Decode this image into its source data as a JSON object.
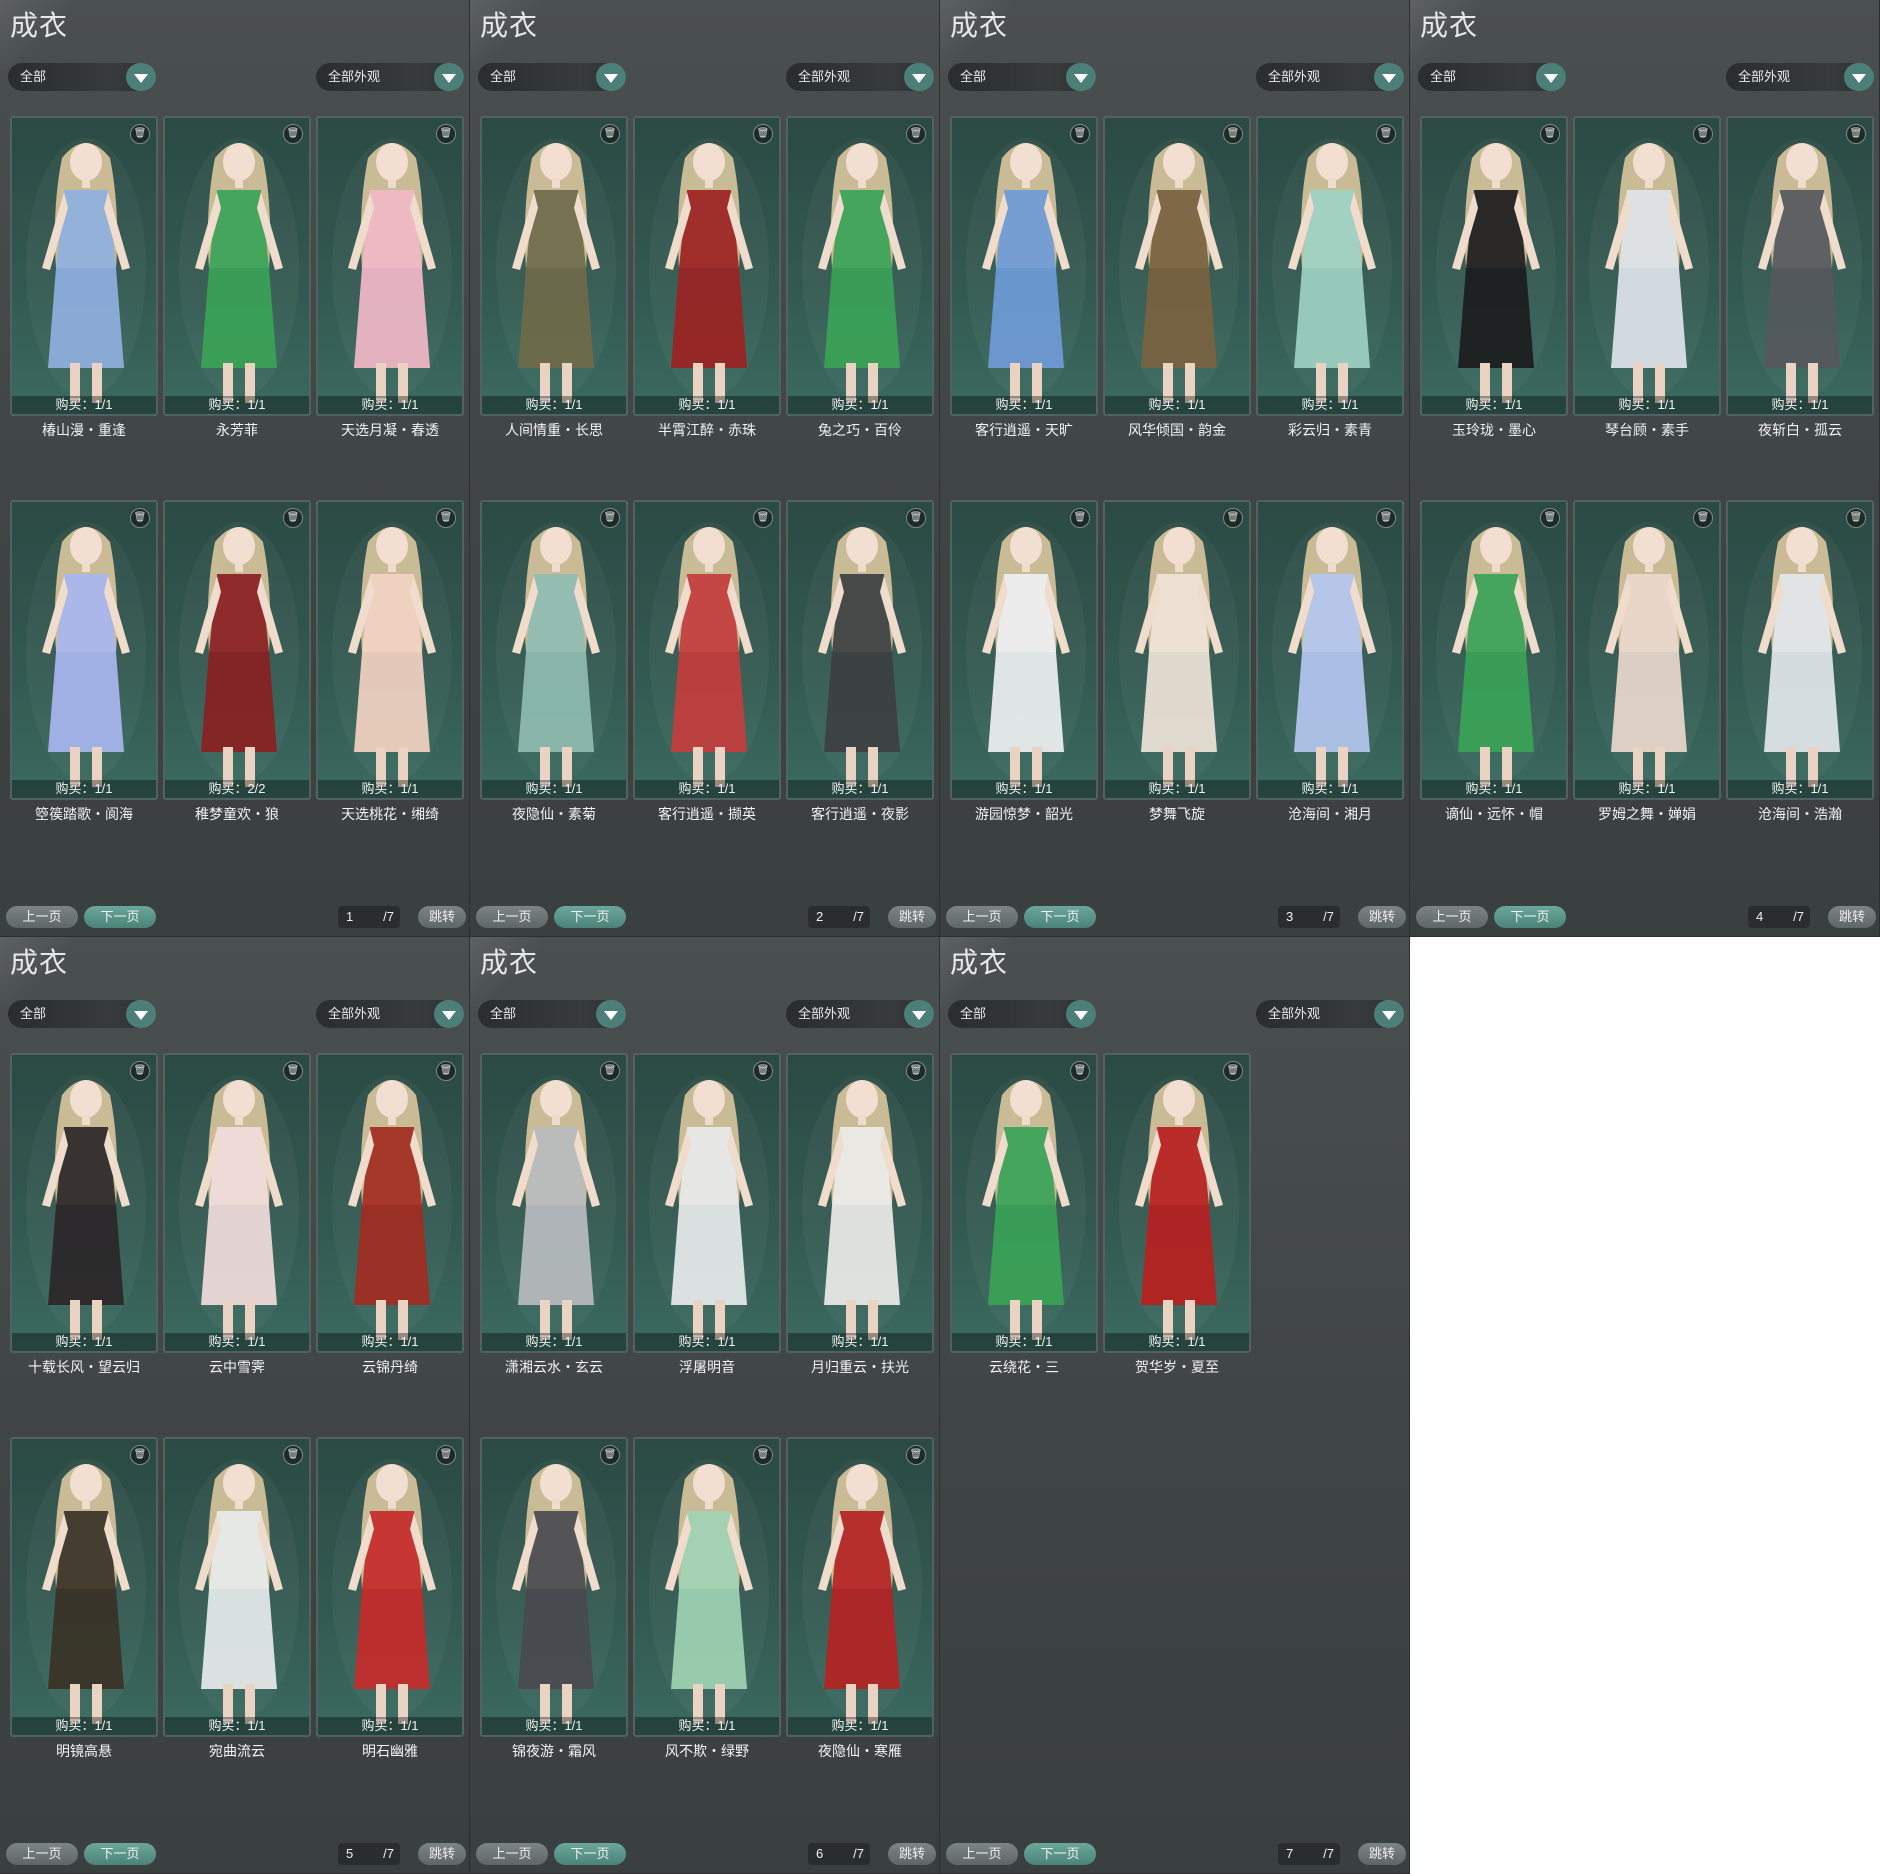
{
  "pages": [
    {
      "title": "成衣",
      "filter_left": "全部",
      "filter_right": "全部外观",
      "prev_label": "上一页",
      "next_label": "下一页",
      "page_number": "1",
      "page_total": "/7",
      "jump_label": "跳转",
      "items": [
        {
          "name": "椿山漫・重逢",
          "buy": "购买：1/1",
          "color": "#8fb0e0"
        },
        {
          "name": "永芳菲",
          "buy": "购买：1/1",
          "color": "#3aa357"
        },
        {
          "name": "天选月凝・春透",
          "buy": "购买：1/1",
          "color": "#f2b8c8"
        },
        {
          "name": "箜篌踏歌・阆海",
          "buy": "购买：1/1",
          "color": "#a9b6f0"
        },
        {
          "name": "稚梦童欢・狼",
          "buy": "购买：2/2",
          "color": "#8a1f22"
        },
        {
          "name": "天选桃花・缃绮",
          "buy": "购买：1/1",
          "color": "#f3d3c2"
        }
      ]
    },
    {
      "title": "成衣",
      "filter_left": "全部",
      "filter_right": "全部外观",
      "prev_label": "上一页",
      "next_label": "下一页",
      "page_number": "2",
      "page_total": "/7",
      "jump_label": "跳转",
      "items": [
        {
          "name": "人间情重・长思",
          "buy": "购买：1/1",
          "color": "#6f6a4a"
        },
        {
          "name": "半霄江醉・赤珠",
          "buy": "购买：1/1",
          "color": "#9c2323"
        },
        {
          "name": "兔之巧・百伶",
          "buy": "购买：1/1",
          "color": "#3aa357"
        },
        {
          "name": "夜隐仙・素菊",
          "buy": "购买：1/1",
          "color": "#8fbcb2"
        },
        {
          "name": "客行逍遥・撷英",
          "buy": "购买：1/1",
          "color": "#c43d3d"
        },
        {
          "name": "客行逍遥・夜影",
          "buy": "购买：1/1",
          "color": "#3d3f42"
        }
      ]
    },
    {
      "title": "成衣",
      "filter_left": "全部",
      "filter_right": "全部外观",
      "prev_label": "上一页",
      "next_label": "下一页",
      "page_number": "3",
      "page_total": "/7",
      "jump_label": "跳转",
      "items": [
        {
          "name": "客行逍遥・天旷",
          "buy": "购买：1/1",
          "color": "#6f9bd8"
        },
        {
          "name": "风华倾国・韵金",
          "buy": "购买：1/1",
          "color": "#7a6240"
        },
        {
          "name": "彩云归・素青",
          "buy": "购买：1/1",
          "color": "#9ed1c4"
        },
        {
          "name": "游园惊梦・韶光",
          "buy": "购买：1/1",
          "color": "#eef0f2"
        },
        {
          "name": "梦舞飞旋",
          "buy": "购买：1/1",
          "color": "#efe4d8"
        },
        {
          "name": "沧海间・湘月",
          "buy": "购买：1/1",
          "color": "#b4c7ef"
        }
      ]
    },
    {
      "title": "成衣",
      "filter_left": "全部",
      "filter_right": "全部外观",
      "prev_label": "上一页",
      "next_label": "下一页",
      "page_number": "4",
      "page_total": "/7",
      "jump_label": "跳转",
      "items": [
        {
          "name": "玉玲珑・墨心",
          "buy": "购买：1/1",
          "color": "#1c1c1e"
        },
        {
          "name": "琴台顾・素手",
          "buy": "购买：1/1",
          "color": "#dfe4ea"
        },
        {
          "name": "夜斩白・孤云",
          "buy": "购买：1/1",
          "color": "#55585c"
        },
        {
          "name": "谪仙・远怀・帽",
          "buy": "购买：1/1",
          "color": "#3aa357"
        },
        {
          "name": "罗姆之舞・婵娟",
          "buy": "购买：1/1",
          "color": "#ead8cc"
        },
        {
          "name": "沧海间・浩瀚",
          "buy": "购买：1/1",
          "color": "#e2e7ec"
        }
      ]
    },
    {
      "title": "成衣",
      "filter_left": "全部",
      "filter_right": "全部外观",
      "prev_label": "上一页",
      "next_label": "下一页",
      "page_number": "5",
      "page_total": "/7",
      "jump_label": "跳转",
      "items": [
        {
          "name": "十载长风・望云归",
          "buy": "购买：1/1",
          "color": "#2b2628"
        },
        {
          "name": "云中雪霁",
          "buy": "购买：1/1",
          "color": "#f1dcdc"
        },
        {
          "name": "云锦丹绮",
          "buy": "购买：1/1",
          "color": "#a32b22"
        },
        {
          "name": "明镜高悬",
          "buy": "购买：1/1",
          "color": "#3a3226"
        },
        {
          "name": "宛曲流云",
          "buy": "购买：1/1",
          "color": "#e7ecec"
        },
        {
          "name": "明石幽雅",
          "buy": "购买：1/1",
          "color": "#c62a2a"
        }
      ]
    },
    {
      "title": "成衣",
      "filter_left": "全部",
      "filter_right": "全部外观",
      "prev_label": "上一页",
      "next_label": "下一页",
      "page_number": "6",
      "page_total": "/7",
      "jump_label": "跳转",
      "items": [
        {
          "name": "潇湘云水・玄云",
          "buy": "购买：1/1",
          "color": "#b8bcbf"
        },
        {
          "name": "浮屠明音",
          "buy": "购买：1/1",
          "color": "#e8eaec"
        },
        {
          "name": "月归重云・扶光",
          "buy": "购买：1/1",
          "color": "#ecebe8"
        },
        {
          "name": "锦夜游・霜风",
          "buy": "购买：1/1",
          "color": "#4a4a4f"
        },
        {
          "name": "风不欺・绿野",
          "buy": "购买：1/1",
          "color": "#9fd2b3"
        },
        {
          "name": "夜隐仙・寒雁",
          "buy": "购买：1/1",
          "color": "#b52323"
        }
      ]
    },
    {
      "title": "成衣",
      "filter_left": "全部",
      "filter_right": "全部外观",
      "prev_label": "上一页",
      "next_label": "下一页",
      "page_number": "7",
      "page_total": "/7",
      "jump_label": "跳转",
      "items": [
        {
          "name": "云绕花・三",
          "buy": "购买：1/1",
          "color": "#3aa357"
        },
        {
          "name": "贺华岁・夏至",
          "buy": "购买：1/1",
          "color": "#b81f1f"
        }
      ]
    }
  ]
}
